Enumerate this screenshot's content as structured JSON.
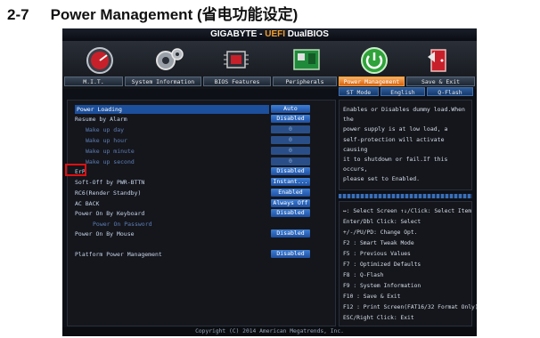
{
  "heading": {
    "number": "2-7",
    "title": "Power Management (省电功能设定)"
  },
  "titlebar": {
    "brand": "GIGABYTE - ",
    "uefi": "UEFI",
    "product": " DualBIOS"
  },
  "tabs": [
    {
      "label": "M.I.T.",
      "icon": "speedometer-icon"
    },
    {
      "label": "System Information",
      "icon": "gears-icon"
    },
    {
      "label": "BIOS Features",
      "icon": "chip-icon"
    },
    {
      "label": "Peripherals",
      "icon": "card-icon"
    },
    {
      "label": "Power Management",
      "icon": "power-icon",
      "active": true
    },
    {
      "label": "Save & Exit",
      "icon": "exit-door-icon"
    }
  ],
  "subtabs": {
    "st_mode": "ST Mode",
    "language": "English",
    "qflash": "Q-Flash"
  },
  "settings": [
    {
      "label": "Power Loading",
      "value": "Auto",
      "highlight": true
    },
    {
      "label": "Resume by Alarm",
      "value": "Disabled"
    },
    {
      "label": "Wake up day",
      "value": "0",
      "sub": true
    },
    {
      "label": "Wake up hour",
      "value": "0",
      "sub": true
    },
    {
      "label": "Wake up minute",
      "value": "0",
      "sub": true
    },
    {
      "label": "Wake up second",
      "value": "0",
      "sub": true
    },
    {
      "label": "ErP",
      "value": "Disabled"
    },
    {
      "label": "Soft-Off by PWR-BTTN",
      "value": "Instant..."
    },
    {
      "label": "RC6(Render Standby)",
      "value": "Enabled"
    },
    {
      "label": "AC BACK",
      "value": "Always Off"
    },
    {
      "label": "Power On By Keyboard",
      "value": "Disabled"
    },
    {
      "label": "Power On Password",
      "value": "",
      "sub": true
    },
    {
      "label": "Power On By Mouse",
      "value": "Disabled"
    },
    {
      "label": "Platform Power Management",
      "value": "Disabled"
    }
  ],
  "help": {
    "lines": [
      "Enables or Disables dummy load.When the",
      "power supply is at low load, a",
      "self-protection will activate causing",
      "it to shutdown or fail.If this occurs,",
      "please set to Enabled."
    ]
  },
  "keys": [
    "↔: Select Screen  ↑↓/Click: Select Item",
    "Enter/Dbl Click: Select",
    "+/-/PU/PD: Change Opt.",
    "F2  : Smart Tweak Mode",
    "F5  : Previous Values",
    "F7  : Optimized Defaults",
    "F8  : Q-Flash",
    "F9  : System Information",
    "F10 : Save & Exit",
    "F12 : Print Screen(FAT16/32 Format Only)",
    "ESC/Right Click: Exit"
  ],
  "footer": "Copyright (C) 2014 American Megatrends, Inc."
}
